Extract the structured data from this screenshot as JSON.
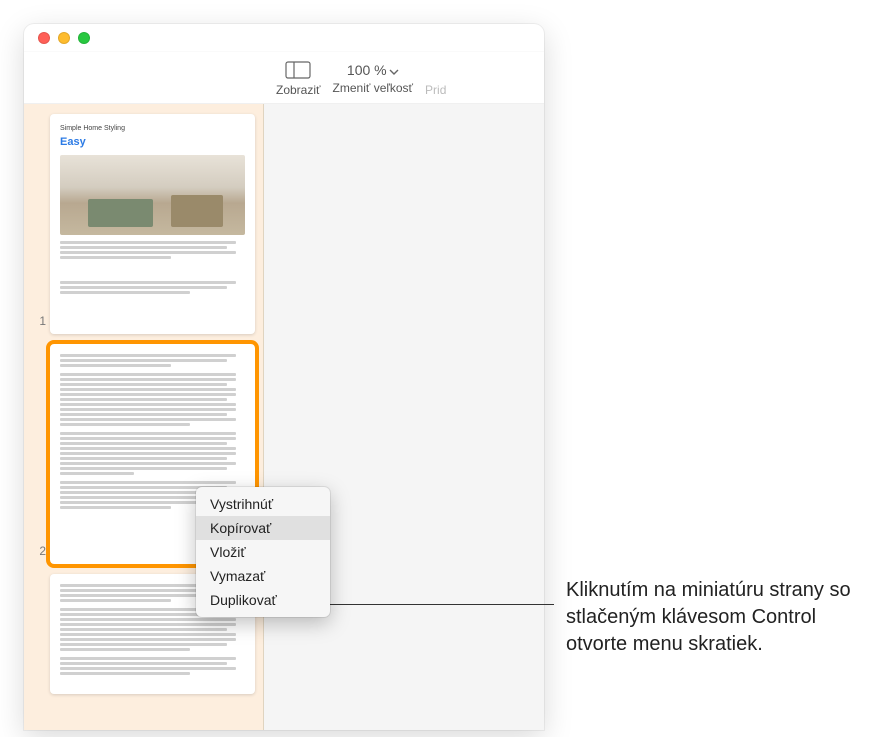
{
  "toolbar": {
    "view_label": "Zobraziť",
    "zoom_label": "Zmeniť veľkosť",
    "zoom_value": "100 %",
    "next_label_partial": "Prid"
  },
  "sidebar": {
    "pages": [
      {
        "num": "1",
        "title": "Simple Home Styling",
        "accent": "Easy"
      },
      {
        "num": "2"
      },
      {
        "num": ""
      }
    ]
  },
  "context_menu": {
    "items": [
      "Vystrihnúť",
      "Kopírovať",
      "Vložiť",
      "Vymazať",
      "Duplikovať"
    ],
    "highlighted_index": 1
  },
  "callout": {
    "text": "Kliknutím na miniatúru strany so stlačeným klávesom Control otvorte menu skratiek."
  }
}
